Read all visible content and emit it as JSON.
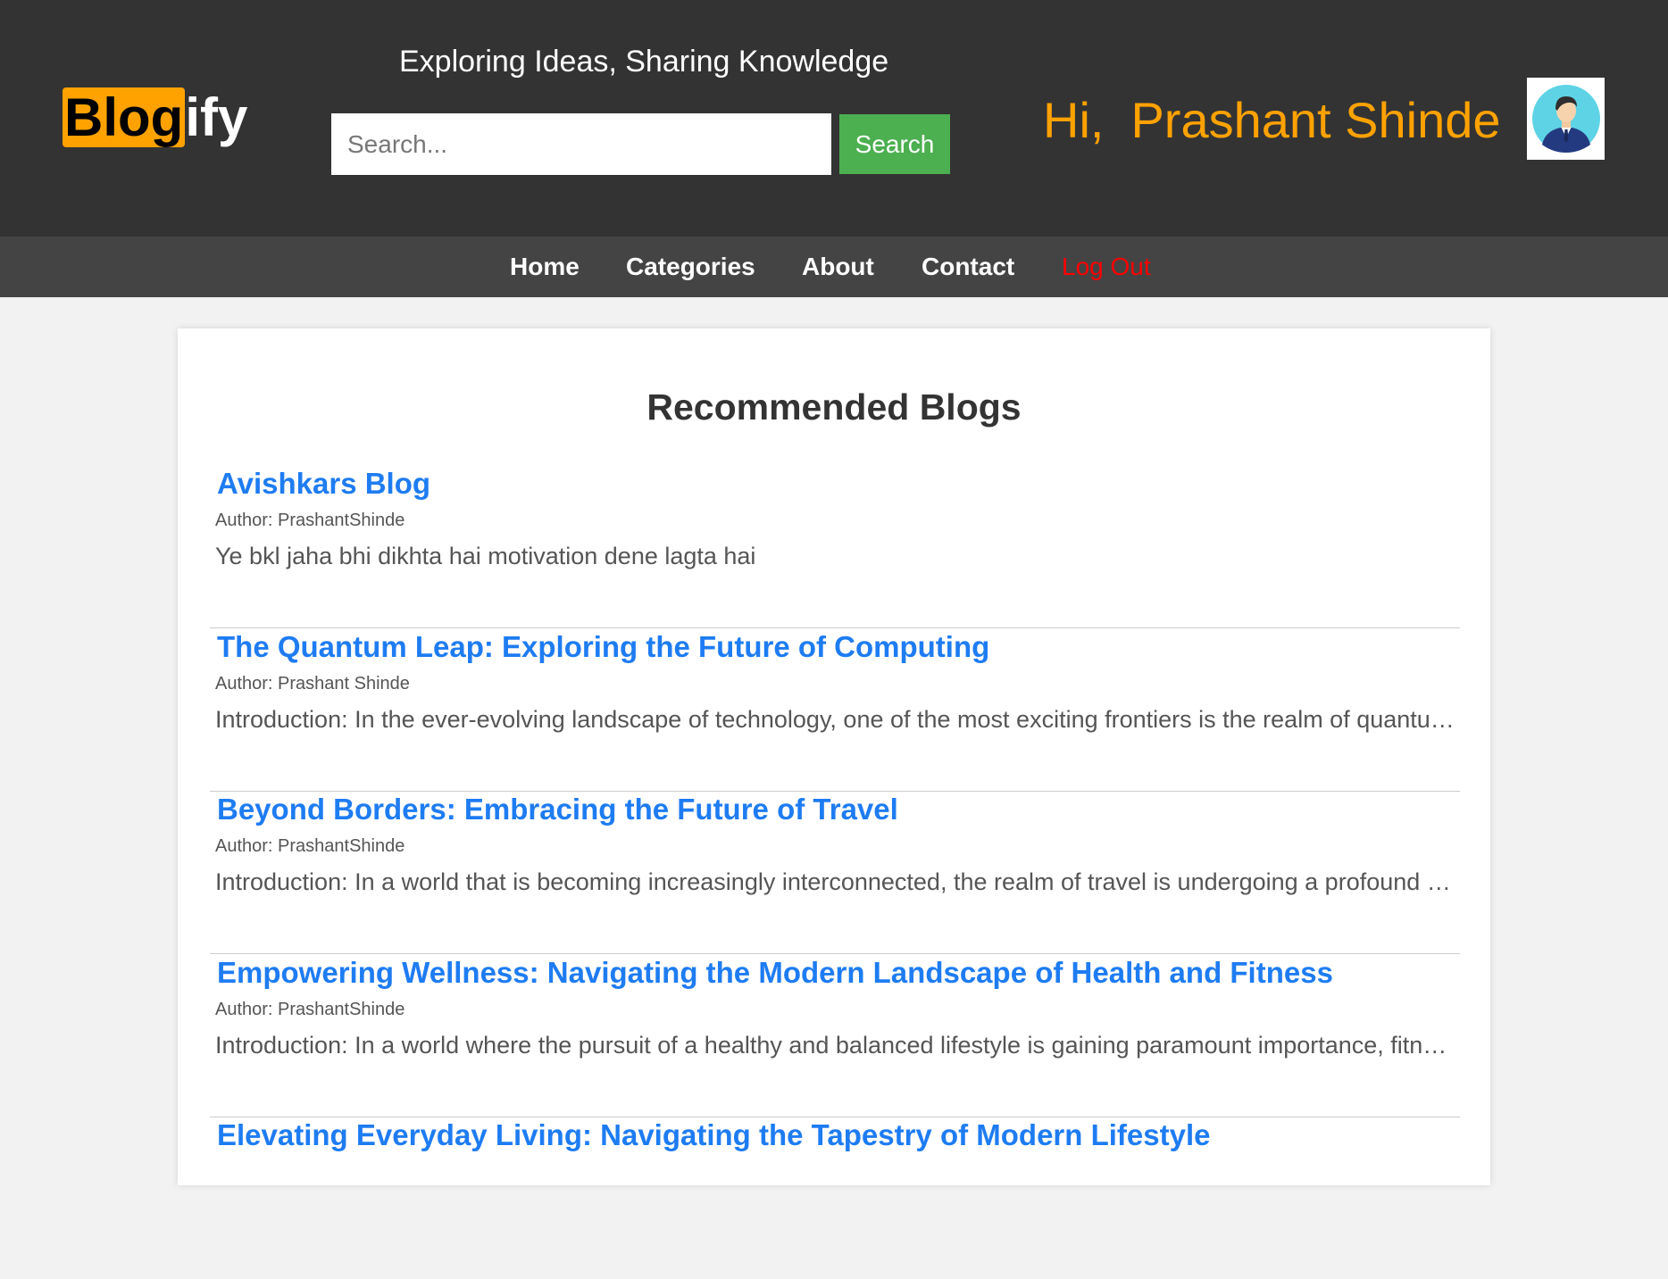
{
  "header": {
    "logo_highlight": "Blog",
    "logo_rest": "ify",
    "tagline": "Exploring Ideas, Sharing Knowledge",
    "search": {
      "placeholder": "Search...",
      "value": "",
      "button_label": "Search"
    },
    "greeting_hi": "Hi,",
    "greeting_name": "Prashant Shinde",
    "avatar_icon": "user-avatar-icon"
  },
  "nav": {
    "items": [
      {
        "label": "Home"
      },
      {
        "label": "Categories"
      },
      {
        "label": "About"
      },
      {
        "label": "Contact"
      },
      {
        "label": "Log Out"
      }
    ]
  },
  "main": {
    "title": "Recommended Blogs",
    "blogs": [
      {
        "title": "Avishkars Blog",
        "author": "Author: PrashantShinde",
        "excerpt": "Ye bkl jaha bhi dikhta hai motivation dene lagta hai"
      },
      {
        "title": "The Quantum Leap: Exploring the Future of Computing",
        "author": "Author: Prashant Shinde",
        "excerpt": "Introduction: In the ever-evolving landscape of technology, one of the most exciting frontiers is the realm of quantum computing."
      },
      {
        "title": "Beyond Borders: Embracing the Future of Travel",
        "author": "Author: PrashantShinde",
        "excerpt": "Introduction: In a world that is becoming increasingly interconnected, the realm of travel is undergoing a profound transformation."
      },
      {
        "title": "Empowering Wellness: Navigating the Modern Landscape of Health and Fitness",
        "author": "Author: PrashantShinde",
        "excerpt": "Introduction: In a world where the pursuit of a healthy and balanced lifestyle is gaining paramount importance, fitness matters."
      },
      {
        "title": "Elevating Everyday Living: Navigating the Tapestry of Modern Lifestyle",
        "author": "",
        "excerpt": ""
      }
    ]
  },
  "colors": {
    "header_bg": "#333333",
    "nav_bg": "#444444",
    "accent": "#ffa200",
    "search_button": "#4caf50",
    "link": "#1e7cf2",
    "logout": "#ff0000"
  }
}
